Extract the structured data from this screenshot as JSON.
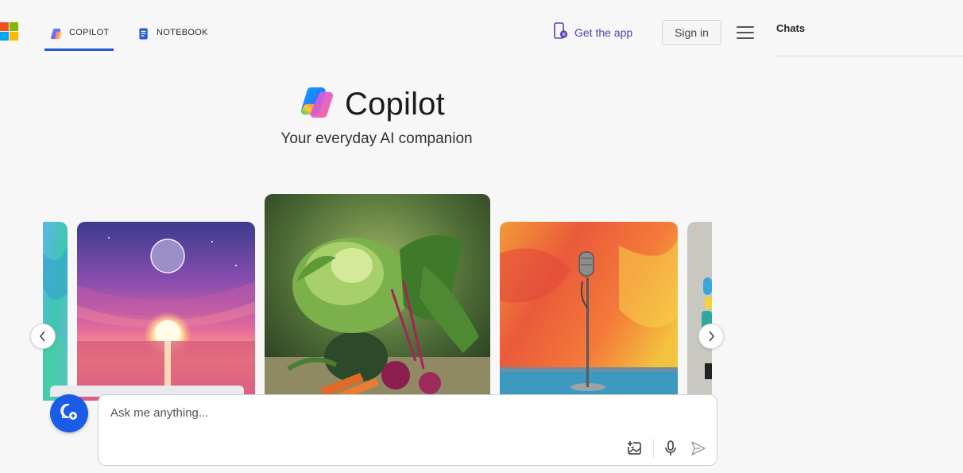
{
  "header": {
    "logo_icon": "microsoft-logo-icon",
    "tabs": [
      {
        "label": "COPILOT",
        "icon": "copilot-icon",
        "active": true
      },
      {
        "label": "NOTEBOOK",
        "icon": "notebook-icon",
        "active": false
      }
    ],
    "get_app_label": "Get the app",
    "sign_in_label": "Sign in",
    "menu_icon": "hamburger-menu-icon"
  },
  "sidebar": {
    "title": "Chats"
  },
  "hero": {
    "brand_name": "Copilot",
    "tagline": "Your everyday AI companion"
  },
  "carousel": {
    "cards": [
      {
        "name": "partial-abstract-card"
      },
      {
        "name": "sunset-moon-card"
      },
      {
        "name": "vegetables-card",
        "featured": true
      },
      {
        "name": "microphone-card"
      },
      {
        "name": "partial-figurine-card"
      }
    ],
    "prev_icon": "chevron-left-icon",
    "next_icon": "chevron-right-icon"
  },
  "composer": {
    "placeholder": "Ask me anything...",
    "new_chat_icon": "new-chat-icon",
    "image_icon": "add-image-icon",
    "mic_icon": "microphone-icon",
    "send_icon": "send-icon"
  },
  "colors": {
    "accent": "#2557d6",
    "new_chat": "#1a5ce6",
    "get_app": "#5b3bb3",
    "background": "#f7f7f7"
  }
}
